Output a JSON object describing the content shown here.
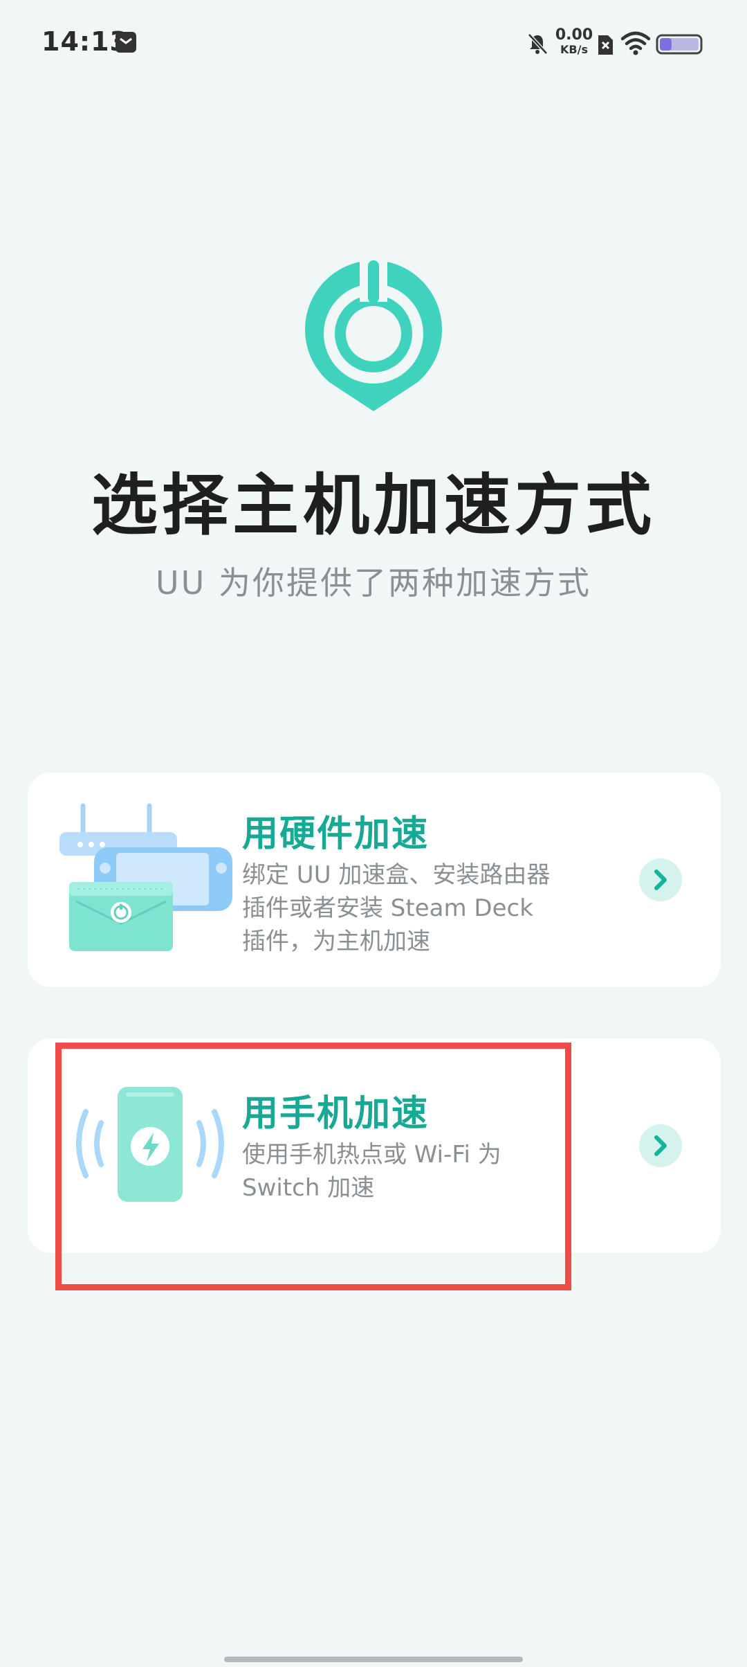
{
  "status_bar": {
    "time": "14:13",
    "net_speed_value": "0.00",
    "net_speed_unit": "KB/s",
    "battery_level": 0.3,
    "icons": [
      "notification-icon",
      "mute-icon",
      "sim-icon",
      "wifi-icon",
      "battery-icon"
    ]
  },
  "header": {
    "title": "选择主机加速方式",
    "subtitle": "UU 为你提供了两种加速方式"
  },
  "options": {
    "hardware": {
      "title": "用硬件加速",
      "desc_lines": [
        "绑定 UU 加速盒、安装路由器",
        "插件或者安装 Steam Deck",
        "插件，为主机加速"
      ]
    },
    "phone": {
      "title": "用手机加速",
      "desc_lines": [
        "使用手机热点或 Wi-Fi 为",
        "Switch 加速"
      ]
    }
  },
  "colors": {
    "accent": "#17a994",
    "logo": "#3fd3bd",
    "highlight": "#ec4d47",
    "background": "#f1f6f6"
  }
}
